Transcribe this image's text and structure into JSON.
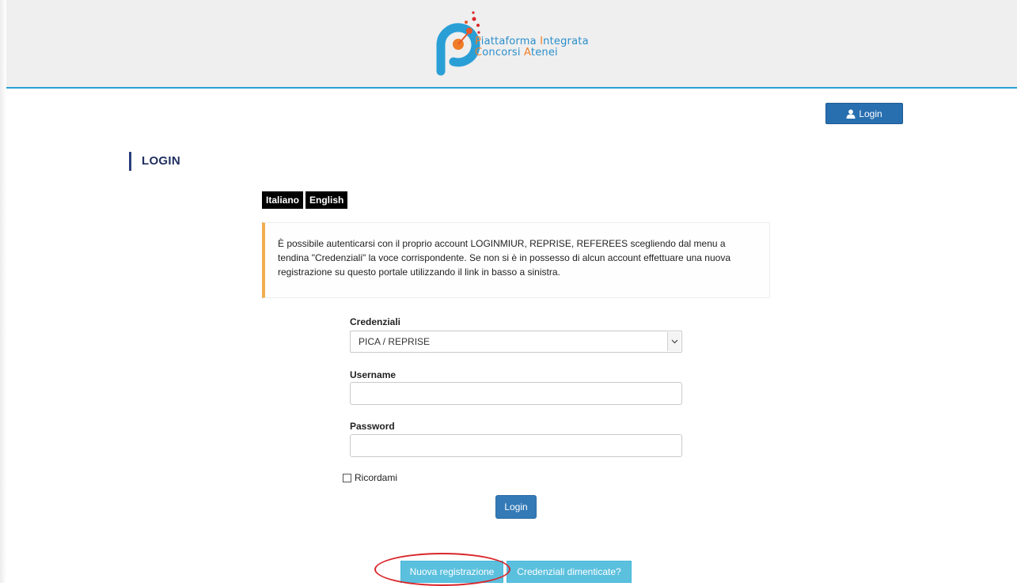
{
  "header": {
    "logo": {
      "line1_accent": "P",
      "line1_rest": "iattaforma ",
      "line1_accent2": "I",
      "line1_rest2": "ntegrata",
      "line2_accent": "C",
      "line2_rest": "oncorsi ",
      "line2_accent2": "A",
      "line2_rest2": "tenei"
    }
  },
  "topbar": {
    "login_label": "Login",
    "login_icon": "user-icon"
  },
  "page": {
    "title": "LOGIN"
  },
  "languages": [
    "Italiano",
    "English"
  ],
  "alert": {
    "text": "È possibile autenticarsi con il proprio account LOGINMIUR, REPRISE, REFEREES scegliendo dal menu a tendina \"Credenziali\" la voce corrispondente. Se non si è in possesso di alcun account effettuare una nuova registrazione su questo portale utilizzando il link in basso a sinistra."
  },
  "form": {
    "credentials_label": "Credenziali",
    "credentials_value": "PICA / REPRISE",
    "username_label": "Username",
    "username_value": "",
    "password_label": "Password",
    "password_value": "",
    "remember_label": "Ricordami",
    "remember_checked": false,
    "login_label": "Login"
  },
  "footer_buttons": {
    "register_label": "Nuova registrazione",
    "forgot_label": "Credenziali dimenticate?"
  },
  "colors": {
    "header_line": "#2a9fd6",
    "primary": "#337ab7",
    "info": "#5bc0de",
    "alert_border": "#f0ad4e",
    "highlight": "#d9262b",
    "logo_blue": "#2a8ecb",
    "logo_orange": "#ef7d28"
  }
}
